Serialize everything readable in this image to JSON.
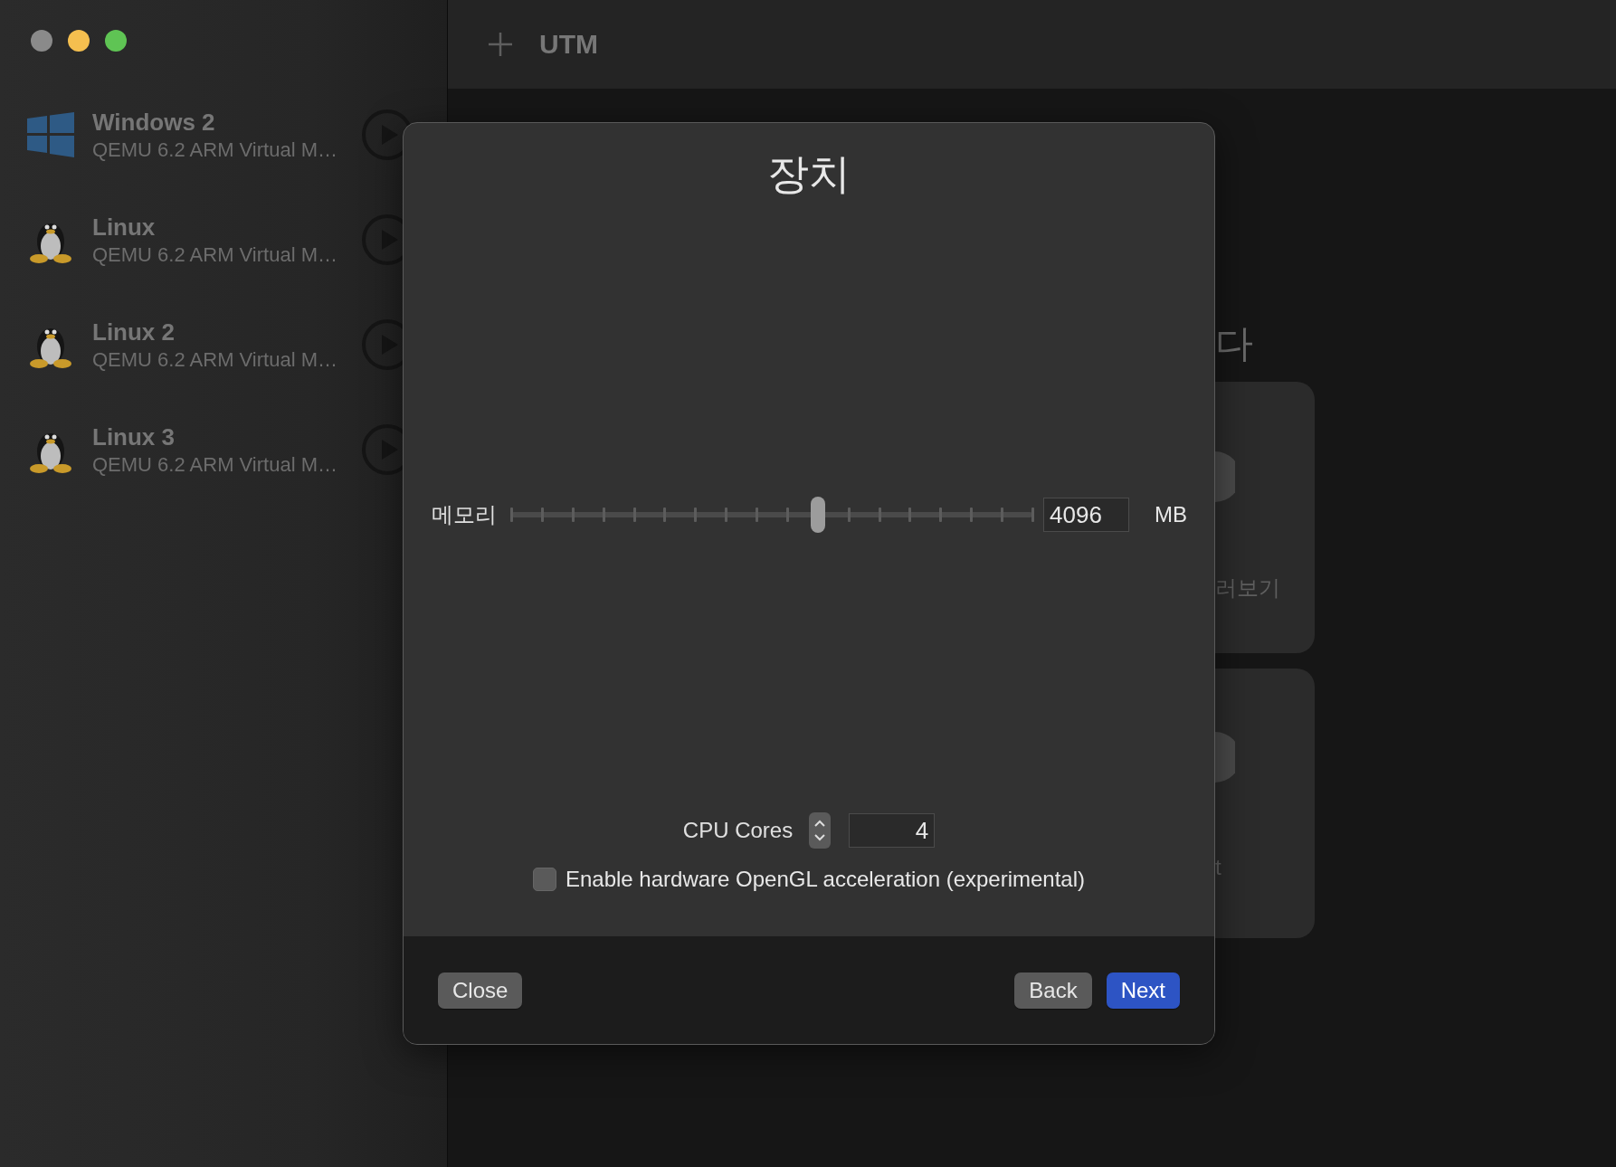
{
  "window": {
    "title": "UTM"
  },
  "sidebar": {
    "items": [
      {
        "name": "Windows 2",
        "subtitle": "QEMU 6.2 ARM Virtual M…",
        "kind": "windows"
      },
      {
        "name": "Linux",
        "subtitle": "QEMU 6.2 ARM Virtual M…",
        "kind": "linux"
      },
      {
        "name": "Linux 2",
        "subtitle": "QEMU 6.2 ARM Virtual M…",
        "kind": "linux"
      },
      {
        "name": "Linux 3",
        "subtitle": "QEMU 6.2 ARM Virtual M…",
        "kind": "linux"
      }
    ]
  },
  "background": {
    "heading": "다",
    "cards": [
      {
        "label": "러보기"
      },
      {
        "label": "t"
      }
    ]
  },
  "dialog": {
    "title": "장치",
    "memory": {
      "label": "메모리",
      "level": 0.588,
      "value": "4096",
      "unit": "MB"
    },
    "cpu": {
      "label": "CPU Cores",
      "value": "4"
    },
    "opengl": {
      "label": "Enable hardware OpenGL acceleration (experimental)",
      "checked": false
    },
    "buttons": [
      {
        "label": "Close",
        "kind": "secondary"
      },
      {
        "label": "Back",
        "kind": "secondary"
      },
      {
        "label": "Next",
        "kind": "primary"
      }
    ]
  }
}
